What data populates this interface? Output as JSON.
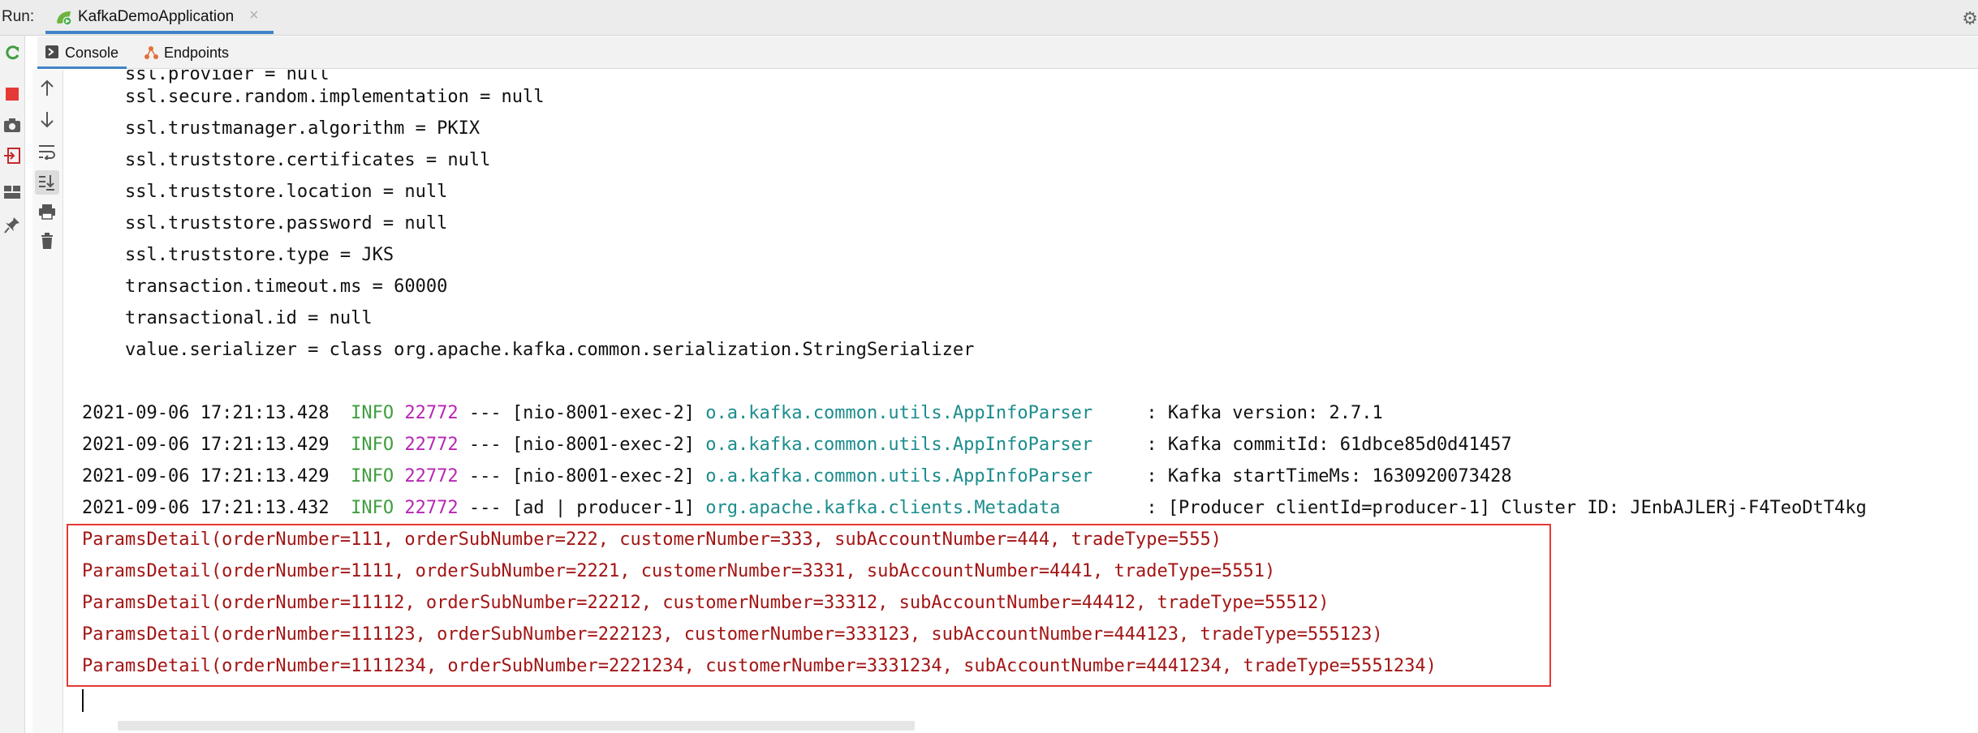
{
  "run_bar": {
    "label": "Run:",
    "tab_name": "KafkaDemoApplication",
    "tab_close": "×",
    "tab_icon": "spring-run-icon",
    "settings_icon": "gear-icon"
  },
  "sub_tabs": [
    {
      "label": "Console",
      "icon": "console-icon",
      "active": true
    },
    {
      "label": "Endpoints",
      "icon": "endpoints-icon",
      "active": false
    }
  ],
  "left_toolbar": [
    "rerun-icon",
    "stop-icon",
    "camera-icon",
    "exit-icon",
    "layout-icon",
    "pin-icon"
  ],
  "console_toolbar": [
    "arrow-up-icon",
    "arrow-down-icon",
    "soft-wrap-icon",
    "scroll-to-end-icon",
    "print-icon",
    "trash-icon"
  ],
  "colors": {
    "info": "#3e9e3e",
    "pid": "#b726b5",
    "logger": "#1c8c8c",
    "params": "#a31515",
    "highlight": "#e53935",
    "accent": "#4083c9"
  },
  "config_lines": [
    "    ssl.provider = null",
    "    ssl.secure.random.implementation = null",
    "    ssl.trustmanager.algorithm = PKIX",
    "    ssl.truststore.certificates = null",
    "    ssl.truststore.location = null",
    "    ssl.truststore.password = null",
    "    ssl.truststore.type = JKS",
    "    transaction.timeout.ms = 60000",
    "    transactional.id = null",
    "    value.serializer = class org.apache.kafka.common.serialization.StringSerializer"
  ],
  "log_lines": [
    {
      "timestamp": "2021-09-06 17:21:13.428",
      "level": "INFO",
      "pid": "22772",
      "thread": "--- [nio-8001-exec-2]",
      "logger": "o.a.kafka.common.utils.AppInfoParser    ",
      "message": " : Kafka version: 2.7.1"
    },
    {
      "timestamp": "2021-09-06 17:21:13.429",
      "level": "INFO",
      "pid": "22772",
      "thread": "--- [nio-8001-exec-2]",
      "logger": "o.a.kafka.common.utils.AppInfoParser    ",
      "message": " : Kafka commitId: 61dbce85d0d41457"
    },
    {
      "timestamp": "2021-09-06 17:21:13.429",
      "level": "INFO",
      "pid": "22772",
      "thread": "--- [nio-8001-exec-2]",
      "logger": "o.a.kafka.common.utils.AppInfoParser    ",
      "message": " : Kafka startTimeMs: 1630920073428"
    },
    {
      "timestamp": "2021-09-06 17:21:13.432",
      "level": "INFO",
      "pid": "22772",
      "thread": "--- [ad | producer-1]",
      "logger": "org.apache.kafka.clients.Metadata       ",
      "message": " : [Producer clientId=producer-1] Cluster ID: JEnbAJLERj-F4TeoDtT4kg"
    }
  ],
  "params_lines": [
    "ParamsDetail(orderNumber=111, orderSubNumber=222, customerNumber=333, subAccountNumber=444, tradeType=555)",
    "ParamsDetail(orderNumber=1111, orderSubNumber=2221, customerNumber=3331, subAccountNumber=4441, tradeType=5551)",
    "ParamsDetail(orderNumber=11112, orderSubNumber=22212, customerNumber=33312, subAccountNumber=44412, tradeType=55512)",
    "ParamsDetail(orderNumber=111123, orderSubNumber=222123, customerNumber=333123, subAccountNumber=444123, tradeType=555123)",
    "ParamsDetail(orderNumber=1111234, orderSubNumber=2221234, customerNumber=3331234, subAccountNumber=4441234, tradeType=5551234)"
  ]
}
